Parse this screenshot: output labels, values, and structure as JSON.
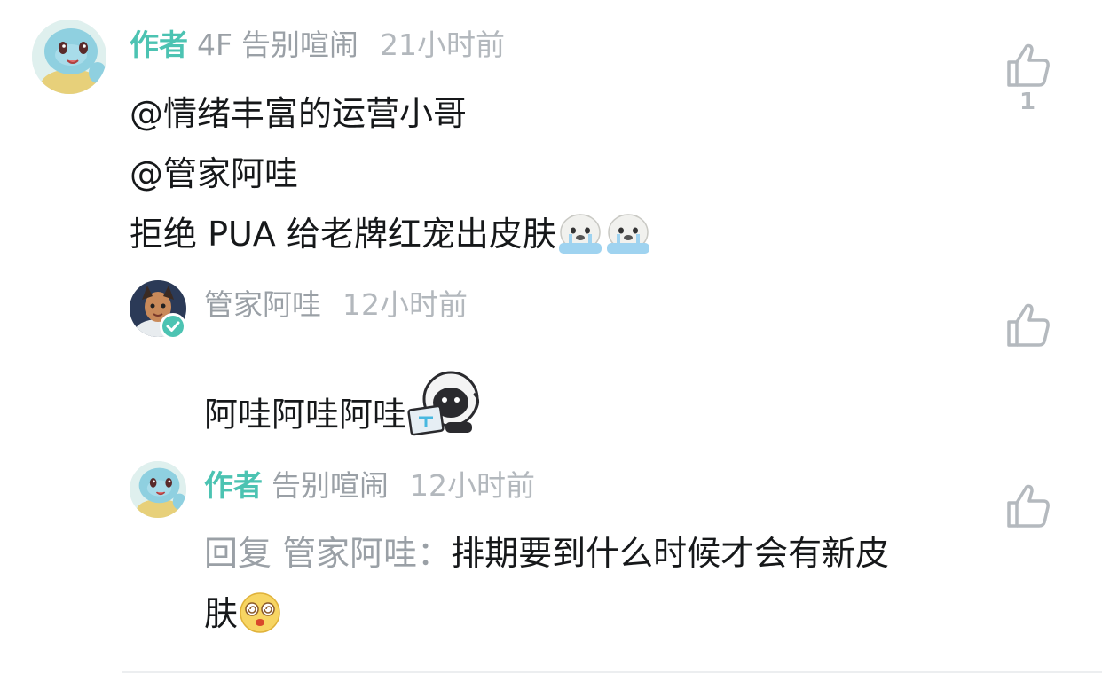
{
  "comment": {
    "author_tag": "作者",
    "floor": "4F",
    "username": "告别喧闹",
    "time": "21小时前",
    "lines": [
      "@情绪丰富的运营小哥",
      "@管家阿哇",
      "拒绝 PUA 给老牌红宠出皮肤"
    ],
    "emojis": [
      "crying-seal-emoji",
      "crying-seal-emoji"
    ],
    "like_count": "1",
    "avatar": "squirtle-avatar"
  },
  "replies": [
    {
      "username": "管家阿哇",
      "time": "12小时前",
      "text": "阿哇阿哇阿哇",
      "emoji": "robot-laptop-sticker",
      "avatar": "anime-character-avatar",
      "verified_badge": "check-badge-icon"
    },
    {
      "author_tag": "作者",
      "username": "告别喧闹",
      "time": "12小时前",
      "reply_prefix": "回复 管家阿哇：",
      "text_line1": "排期要到什么时候才会有新皮",
      "text_line2": "肤",
      "emoji": "dizzy-face-emoji",
      "avatar": "squirtle-avatar"
    }
  ],
  "icons": {
    "like": "thumbs-up-icon"
  },
  "colors": {
    "author_tag": "#4cc3b2",
    "meta_gray": "#9aa0a6",
    "text": "#16181a",
    "icon_gray": "#b4b9be"
  }
}
